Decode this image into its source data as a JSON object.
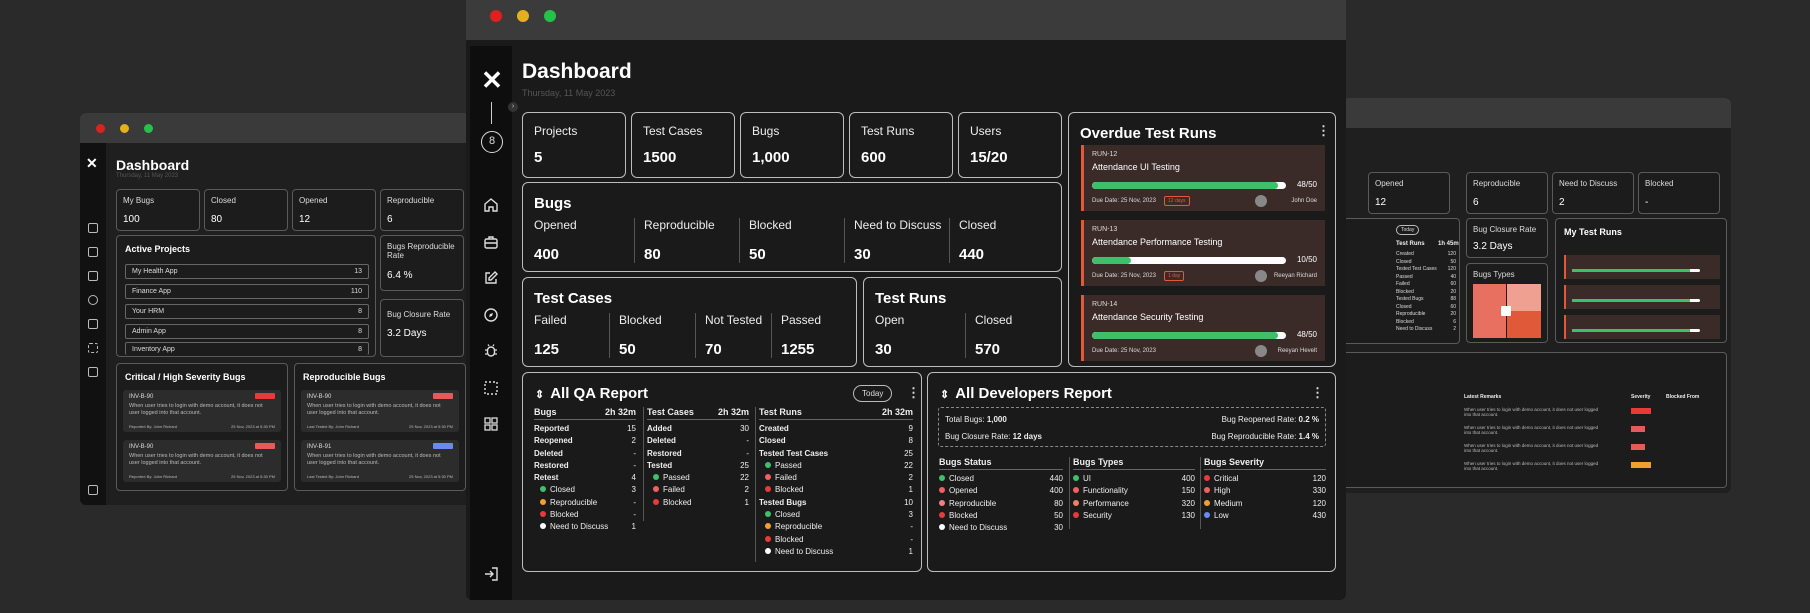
{
  "window": {
    "title": "Dashboard",
    "date": "Thursday, 11 May 2023",
    "dot_colors": [
      "#e0201e",
      "#e4b11b",
      "#24c24a"
    ]
  },
  "stats": [
    {
      "label": "Projects",
      "value": "5"
    },
    {
      "label": "Test Cases",
      "value": "1500"
    },
    {
      "label": "Bugs",
      "value": "1,000"
    },
    {
      "label": "Test Runs",
      "value": "600"
    },
    {
      "label": "Users",
      "value": "15/20"
    }
  ],
  "bugs_card": {
    "title": "Bugs",
    "items": [
      {
        "label": "Opened",
        "value": "400"
      },
      {
        "label": "Reproducible",
        "value": "80"
      },
      {
        "label": "Blocked",
        "value": "50"
      },
      {
        "label": "Need to Discuss",
        "value": "30"
      },
      {
        "label": "Closed",
        "value": "440"
      }
    ]
  },
  "test_cases_card": {
    "title": "Test Cases",
    "items": [
      {
        "label": "Failed",
        "value": "125"
      },
      {
        "label": "Blocked",
        "value": "50"
      },
      {
        "label": "Not Tested",
        "value": "70"
      },
      {
        "label": "Passed",
        "value": "1255"
      }
    ]
  },
  "test_runs_card": {
    "title": "Test Runs",
    "items": [
      {
        "label": "Open",
        "value": "30"
      },
      {
        "label": "Closed",
        "value": "570"
      }
    ]
  },
  "overdue": {
    "title": "Overdue Test Runs",
    "runs": [
      {
        "id": "RUN-12",
        "name": "Attendance UI Testing",
        "progress": "48/50",
        "fraction": 0.96,
        "due": "Due Date: 25 Nov, 2023",
        "tag": "12 days",
        "assignee": "John Doe"
      },
      {
        "id": "RUN-13",
        "name": "Attendance Performance Testing",
        "progress": "10/50",
        "fraction": 0.2,
        "due": "Due Date: 25 Nov, 2023",
        "tag": "1 day",
        "assignee": "Reeyan Richard"
      },
      {
        "id": "RUN-14",
        "name": "Attendance Security Testing",
        "progress": "48/50",
        "fraction": 0.96,
        "due": "Due Date: 25 Nov, 2023",
        "tag": "",
        "assignee": "Reeyan Hevelt"
      }
    ]
  },
  "qa_report": {
    "title": "All QA Report",
    "today": "Today",
    "bugs": {
      "title": "Bugs",
      "time": "2h 32m",
      "rows": [
        {
          "k": "Reported",
          "v": "15"
        },
        {
          "k": "Reopened",
          "v": "2"
        },
        {
          "k": "Deleted",
          "v": "-"
        },
        {
          "k": "Restored",
          "v": "-"
        },
        {
          "k": "Retest",
          "v": "4"
        }
      ],
      "sub": [
        {
          "k": "Closed",
          "v": "3",
          "color": "#3ec06a"
        },
        {
          "k": "Reproducible",
          "v": "-",
          "color": "#f0a030"
        },
        {
          "k": "Blocked",
          "v": "-",
          "color": "#e83a3a"
        },
        {
          "k": "Need to Discuss",
          "v": "1",
          "color": "#ffffff"
        }
      ]
    },
    "test_cases": {
      "title": "Test Cases",
      "time": "2h 32m",
      "rows": [
        {
          "k": "Added",
          "v": "30"
        },
        {
          "k": "Deleted",
          "v": "-"
        },
        {
          "k": "Restored",
          "v": "-"
        },
        {
          "k": "Tested",
          "v": "25"
        }
      ],
      "sub": [
        {
          "k": "Passed",
          "v": "22",
          "color": "#3ec06a"
        },
        {
          "k": "Failed",
          "v": "2",
          "color": "#f06060"
        },
        {
          "k": "Blocked",
          "v": "1",
          "color": "#e83a3a"
        }
      ]
    },
    "test_runs": {
      "title": "Test Runs",
      "time": "2h 32m",
      "rows": [
        {
          "k": "Created",
          "v": "9"
        },
        {
          "k": "Closed",
          "v": "8"
        },
        {
          "k": "Tested Test Cases",
          "v": "25"
        }
      ],
      "sub": [
        {
          "k": "Passed",
          "v": "22",
          "color": "#3ec06a"
        },
        {
          "k": "Failed",
          "v": "2",
          "color": "#f06060"
        },
        {
          "k": "Blocked",
          "v": "1",
          "color": "#e83a3a"
        }
      ],
      "rows2": [
        {
          "k": "Tested Bugs",
          "v": "10"
        }
      ],
      "sub2": [
        {
          "k": "Closed",
          "v": "3",
          "color": "#3ec06a"
        },
        {
          "k": "Reproducible",
          "v": "-",
          "color": "#f0a030"
        },
        {
          "k": "Blocked",
          "v": "-",
          "color": "#e83a3a"
        },
        {
          "k": "Need to Discuss",
          "v": "1",
          "color": "#ffffff"
        }
      ]
    }
  },
  "dev_report": {
    "title": "All Developers Report",
    "total_bugs_label": "Total Bugs:",
    "total_bugs": "1,000",
    "reopened_label": "Bug Reopened Rate:",
    "reopened": "0.2 %",
    "closure_label": "Bug Closure Rate:",
    "closure": "12 days",
    "reproducible_label": "Bug Reproducible Rate:",
    "reproducible": "1.4 %",
    "status": {
      "title": "Bugs Status",
      "rows": [
        {
          "k": "Closed",
          "v": "440",
          "color": "#3ec06a"
        },
        {
          "k": "Opened",
          "v": "400",
          "color": "#f06060"
        },
        {
          "k": "Reproducible",
          "v": "80",
          "color": "#f08080"
        },
        {
          "k": "Blocked",
          "v": "50",
          "color": "#e83a3a"
        },
        {
          "k": "Need to Discuss",
          "v": "30",
          "color": "#ffffff"
        }
      ]
    },
    "types": {
      "title": "Bugs Types",
      "rows": [
        {
          "k": "UI",
          "v": "400",
          "color": "#3ec06a"
        },
        {
          "k": "Functionality",
          "v": "150",
          "color": "#f06060"
        },
        {
          "k": "Performance",
          "v": "320",
          "color": "#f08060"
        },
        {
          "k": "Security",
          "v": "130",
          "color": "#e83a3a"
        }
      ]
    },
    "severity": {
      "title": "Bugs Severity",
      "rows": [
        {
          "k": "Critical",
          "v": "120",
          "color": "#e83a3a"
        },
        {
          "k": "High",
          "v": "330",
          "color": "#f06060"
        },
        {
          "k": "Medium",
          "v": "120",
          "color": "#f0a030"
        },
        {
          "k": "Low",
          "v": "430",
          "color": "#6a8af0"
        }
      ]
    }
  },
  "left_window": {
    "title": "Dashboard",
    "date": "Thursday, 11 May 2023",
    "stats": [
      {
        "label": "My Bugs",
        "value": "100"
      },
      {
        "label": "Closed",
        "value": "80"
      },
      {
        "label": "Opened",
        "value": "12"
      },
      {
        "label": "Reproducible",
        "value": "6"
      }
    ],
    "active_projects": {
      "title": "Active Projects",
      "apps": [
        {
          "name": "My Health App",
          "count": "13"
        },
        {
          "name": "Finance App",
          "count": "110"
        },
        {
          "name": "Your HRM",
          "count": "8"
        },
        {
          "name": "Admin App",
          "count": "8"
        },
        {
          "name": "Inventory App",
          "count": "8"
        }
      ]
    },
    "reproducible_rate": {
      "label": "Bugs Reproducible Rate",
      "value": "6.4 %"
    },
    "closure_rate": {
      "label": "Bug Closure Rate",
      "value": "3.2 Days"
    },
    "critical_title": "Critical / High Severity Bugs",
    "reproducible_title": "Reproducible Bugs",
    "bug_text": "When user tries to login with demo account, it does not user logged into that account.",
    "critical_bugs": [
      {
        "id": "INV-B-90",
        "by": "Reported By: John Richard",
        "when": "25 Nov, 2023 at 5:30 PM"
      },
      {
        "id": "INV-B-90",
        "by": "Reported By: John Richard",
        "when": "25 Nov, 2023 at 5:30 PM"
      }
    ],
    "repro_bugs": [
      {
        "id": "INV-B-90",
        "by": "Last Tested By: John Richard",
        "when": "25 Nov, 2023 at 5:30 PM"
      },
      {
        "id": "INV-B-91",
        "by": "Last Tested By: John Richard",
        "when": "25 Nov, 2023 at 5:30 PM"
      }
    ]
  },
  "right_window": {
    "stats": [
      {
        "label": "Opened",
        "value": "12"
      },
      {
        "label": "Reproducible",
        "value": "6"
      },
      {
        "label": "Need to Discuss",
        "value": "2"
      },
      {
        "label": "Blocked",
        "value": "-"
      }
    ],
    "closure_rate": {
      "label": "Bug Closure Rate",
      "value": "3.2 Days"
    },
    "bug_types": "Bugs Types",
    "my_test_runs": "My Test Runs",
    "today": "Today",
    "test_runs_head": "Test Runs",
    "test_runs_time": "1h 45m",
    "rows": [
      {
        "k": "Created",
        "v": "120"
      },
      {
        "k": "Closed",
        "v": "50"
      },
      {
        "k": "Tested Test Cases",
        "v": "120"
      },
      {
        "k": "Passed",
        "v": "40"
      },
      {
        "k": "Failed",
        "v": "60"
      },
      {
        "k": "Blocked",
        "v": "20"
      },
      {
        "k": "Tested Bugs",
        "v": "88"
      },
      {
        "k": "Closed",
        "v": "60"
      },
      {
        "k": "Reproducible",
        "v": "20"
      },
      {
        "k": "Blocked",
        "v": "6"
      },
      {
        "k": "Need to Discuss",
        "v": "2"
      }
    ],
    "table_headers": [
      "Latest Remarks",
      "Severity",
      "Blocked From"
    ],
    "remark": "When user tries to login with demo account, it does not user logged into that account."
  }
}
